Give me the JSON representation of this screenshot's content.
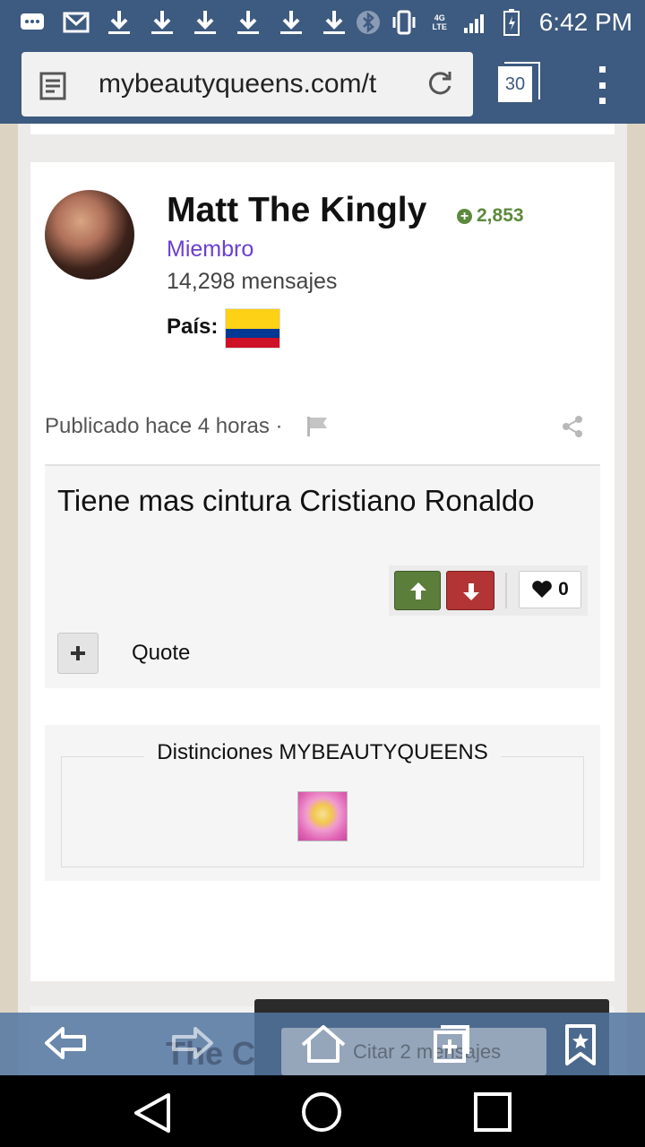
{
  "status_bar": {
    "time": "6:42 PM",
    "network": "4G LTE",
    "icons": [
      "chat-icon",
      "gmail-icon",
      "download-icon",
      "download-icon",
      "download-icon",
      "download-icon",
      "download-icon",
      "download-icon",
      "bluetooth-icon",
      "vibrate-icon",
      "signal-icon",
      "battery-icon"
    ]
  },
  "browser": {
    "url": "mybeautyqueens.com/t",
    "tab_count": "30"
  },
  "post": {
    "author": "Matt The Kingly",
    "reputation": "2,853",
    "role": "Miembro",
    "post_count": "14,298 mensajes",
    "country_label": "País:",
    "country_flag": "colombia-flag",
    "posted_time": "Publicado hace 4 horas ·",
    "body": "Tiene mas cintura Cristiano Ronaldo",
    "like_count": "0",
    "quote_label": "Quote",
    "colors": {
      "role": "#6a3fd0",
      "rep": "#5c8a3c",
      "vote_up": "#5b7e3b",
      "vote_down": "#b23434"
    }
  },
  "distinctions": {
    "title": "Distinciones MYBEAUTYQUEENS"
  },
  "behind": {
    "partial_title": "The C"
  },
  "citar": {
    "label": "Citar 2 mensajes"
  }
}
